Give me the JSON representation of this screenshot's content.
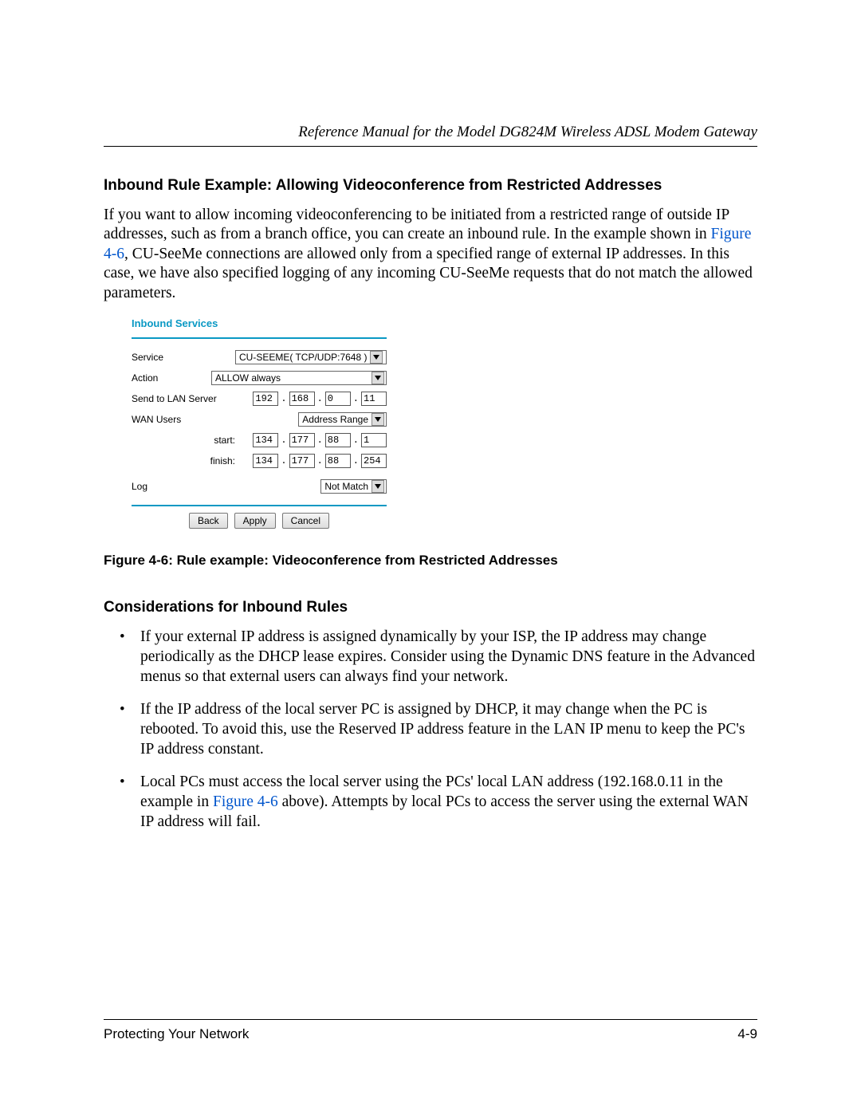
{
  "header": {
    "running_title": "Reference Manual for the Model DG824M Wireless ADSL Modem Gateway"
  },
  "section1": {
    "heading": "Inbound Rule Example: Allowing Videoconference from Restricted Addresses",
    "para_part1": "If you want to allow incoming videoconferencing to be initiated from a restricted range of outside IP addresses, such as from a branch office, you can create an inbound rule. In the example shown in ",
    "figlink": "Figure 4-6",
    "para_part2": ", CU-SeeMe connections are allowed only from a specified range of external IP addresses. In this case, we have also specified logging of any incoming CU-SeeMe requests that do not match the allowed parameters."
  },
  "figure": {
    "panel_title": "Inbound Services",
    "labels": {
      "service": "Service",
      "action": "Action",
      "send_to": "Send to LAN Server",
      "wan_users": "WAN Users",
      "start": "start:",
      "finish": "finish:",
      "log": "Log"
    },
    "values": {
      "service_select": "CU-SEEME( TCP/UDP:7648 )",
      "action_select": "ALLOW always",
      "lan_ip": [
        "192",
        "168",
        "0",
        "11"
      ],
      "wan_select": "Address Range",
      "start_ip": [
        "134",
        "177",
        "88",
        "1"
      ],
      "finish_ip": [
        "134",
        "177",
        "88",
        "254"
      ],
      "log_select": "Not Match"
    },
    "buttons": {
      "back": "Back",
      "apply": "Apply",
      "cancel": "Cancel"
    },
    "caption": "Figure 4-6: Rule example: Videoconference from Restricted Addresses"
  },
  "section2": {
    "heading": "Considerations for Inbound Rules",
    "bullets": [
      "If your external IP address is assigned dynamically by your ISP, the IP address may change periodically as the DHCP lease expires. Consider using the Dynamic DNS feature in the Advanced menus so that external users can always find your network.",
      "If the IP address of the local server PC is assigned by DHCP, it may change when the PC is rebooted. To avoid this, use the Reserved IP address feature in the LAN IP menu to keep the PC's IP address constant."
    ],
    "bullet3_part1": "Local PCs must access the local server using the PCs' local LAN address (192.168.0.11 in the example in ",
    "bullet3_link": "Figure 4-6",
    "bullet3_part2": " above). Attempts by local PCs to access the server using the external WAN IP address will fail."
  },
  "footer": {
    "left": "Protecting Your Network",
    "right": "4-9"
  }
}
